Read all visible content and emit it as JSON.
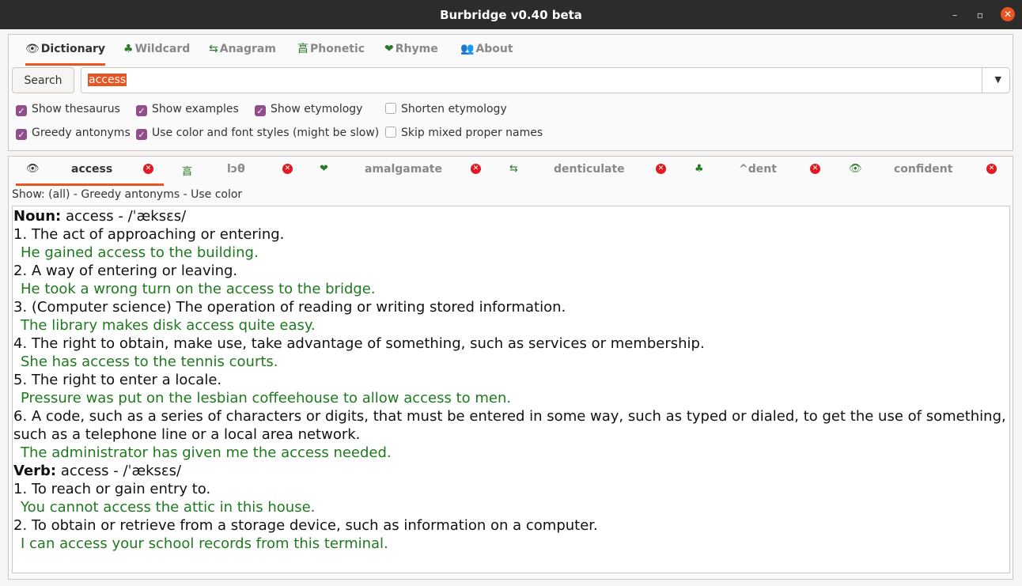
{
  "window": {
    "title": "Burbridge v0.40 beta",
    "min": "–",
    "max": "▫",
    "close": "✕"
  },
  "tabs": [
    {
      "icon": "👁",
      "label": "Dictionary"
    },
    {
      "icon": "♣",
      "label": "Wildcard"
    },
    {
      "icon": "⇆",
      "label": "Anagram"
    },
    {
      "icon": "亯",
      "label": "Phonetic"
    },
    {
      "icon": "❤",
      "label": "Rhyme"
    },
    {
      "icon": "👥",
      "label": "About"
    }
  ],
  "search": {
    "button": "Search",
    "value": "access",
    "dropdown": "▼"
  },
  "options": [
    {
      "label": "Show thesaurus",
      "checked": true
    },
    {
      "label": "Show examples",
      "checked": true
    },
    {
      "label": "Show etymology",
      "checked": true
    },
    {
      "label": "Shorten etymology",
      "checked": false
    },
    {
      "label": "Greedy antonyms",
      "checked": true
    },
    {
      "label": "Use color and font styles (might be slow)",
      "checked": true
    },
    {
      "label": "Skip mixed proper names",
      "checked": false
    }
  ],
  "result_tabs": [
    {
      "icon": "👁",
      "label": "access",
      "close": "✕"
    },
    {
      "icon": "亯",
      "label": "lɔθ",
      "close": "✕"
    },
    {
      "icon": "❤",
      "label": "amalgamate",
      "close": "✕"
    },
    {
      "icon": "⇆",
      "label": "denticulate",
      "close": "✕"
    },
    {
      "icon": "♣",
      "label": "^dent",
      "close": "✕"
    },
    {
      "icon": "👁",
      "label": "confident",
      "close": "✕"
    }
  ],
  "show_line": "Show: (all) - Greedy antonyms - Use color",
  "entry": {
    "noun_head": "Noun:",
    "noun_pron": " access - /ˈæksɛs/",
    "noun_senses": [
      {
        "def": "1. The act of approaching or entering.",
        "ex": "He gained access to the building."
      },
      {
        "def": "2. A way of entering or leaving.",
        "ex": "He took a wrong turn on the access to the bridge."
      },
      {
        "def": "3. (Computer science) The operation of reading or writing stored information.",
        "ex": "The library makes disk access quite easy."
      },
      {
        "def": "4. The right to obtain, make use, take advantage of something, such as services or membership.",
        "ex": "She has access to the tennis courts."
      },
      {
        "def": "5. The right to enter a locale.",
        "ex": "Pressure was put on the lesbian coffeehouse to allow access to men."
      },
      {
        "def": "6. A code, such as a series of characters or digits, that must be entered in some way, such as typed or dialed, to get the use of something, such as a telephone line or a local area network.",
        "ex": "The administrator has given me the access needed."
      }
    ],
    "verb_head": "Verb:",
    "verb_pron": " access - /ˈæksɛs/",
    "verb_senses": [
      {
        "def": "1. To reach or gain entry to.",
        "ex": "You cannot access the attic in this house."
      },
      {
        "def": "2. To obtain or retrieve from a storage device, such as information on a computer.",
        "ex": "I can access your school records from this terminal."
      }
    ]
  }
}
